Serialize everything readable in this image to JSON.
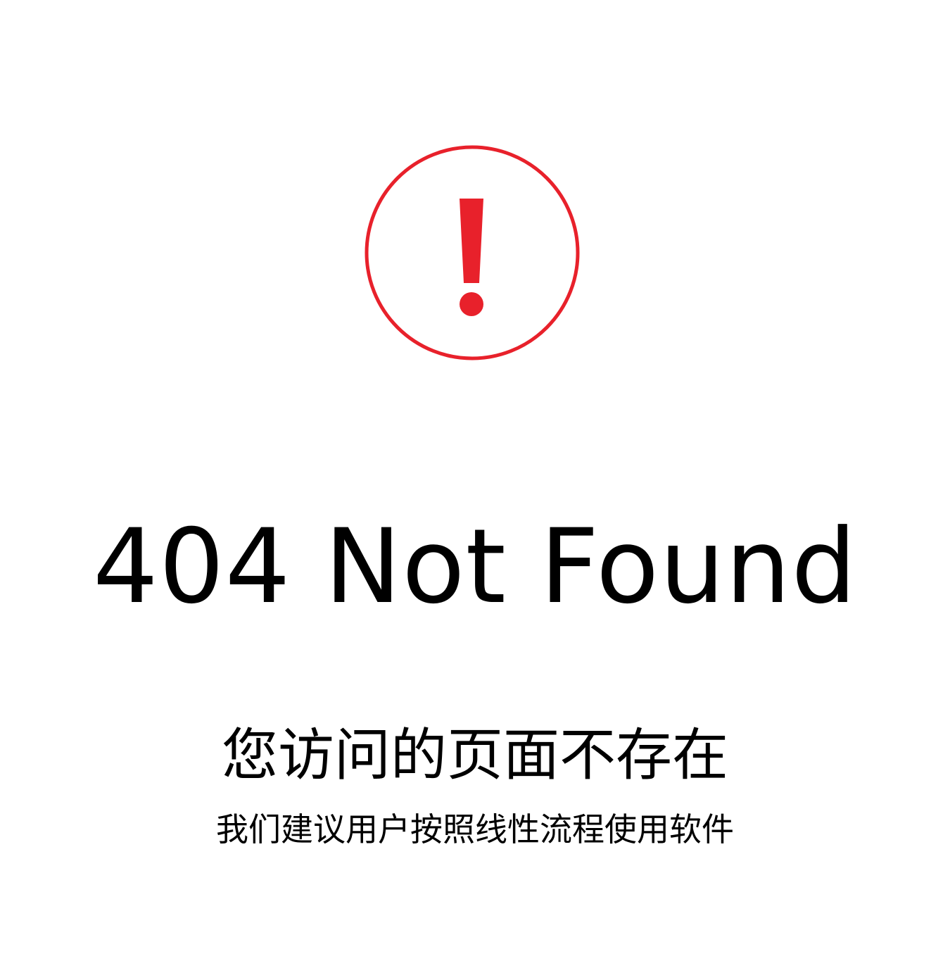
{
  "page": {
    "icon": "exclamation-circle-icon",
    "accent_color": "#e8212b",
    "title": "404 Not Found",
    "message": "您访问的页面不存在",
    "hint": "我们建议用户按照线性流程使用软件"
  }
}
